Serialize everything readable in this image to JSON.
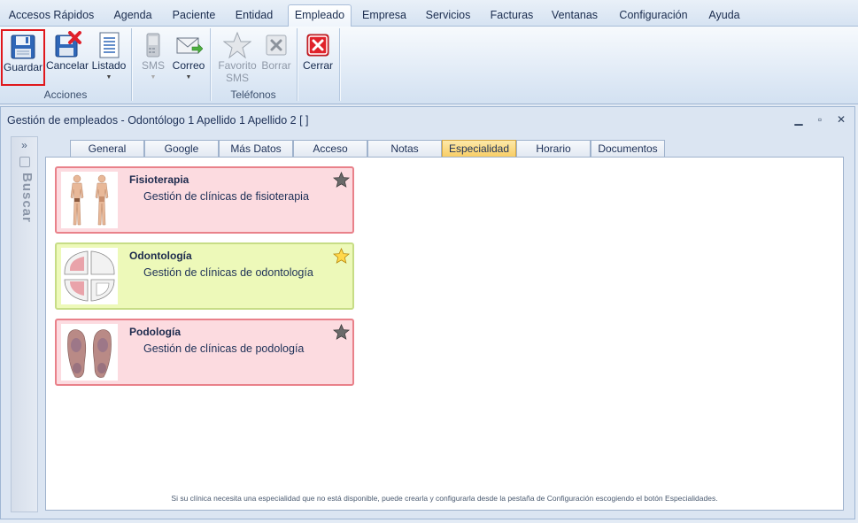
{
  "menu": {
    "tabs": [
      {
        "label": "Accesos Rápidos"
      },
      {
        "label": "Agenda"
      },
      {
        "label": "Paciente"
      },
      {
        "label": "Entidad"
      },
      {
        "label": "Empleado"
      },
      {
        "label": "Empresa"
      },
      {
        "label": "Servicios"
      },
      {
        "label": "Facturas"
      },
      {
        "label": "Ventanas"
      },
      {
        "label": "Configuración"
      },
      {
        "label": "Ayuda"
      }
    ],
    "active": "Empleado"
  },
  "ribbon": {
    "acciones": {
      "group_label": "Acciones",
      "guardar": "Guardar",
      "cancelar": "Cancelar",
      "listado": "Listado"
    },
    "telefonos": {
      "group_label": "Teléfonos",
      "sms": "SMS",
      "correo": "Correo",
      "favorito_sms": "Favorito\nSMS",
      "borrar": "Borrar"
    },
    "cerrar": "Cerrar"
  },
  "window": {
    "title": "Gestión de empleados - Odontólogo 1 Apellido 1 Apellido 2  [ ]",
    "search_panel_label": "Buscar"
  },
  "tabs": [
    {
      "label": "General"
    },
    {
      "label": "Google"
    },
    {
      "label": "Más Datos"
    },
    {
      "label": "Acceso"
    },
    {
      "label": "Notas"
    },
    {
      "label": "Especialidad"
    },
    {
      "label": "Horario"
    },
    {
      "label": "Documentos"
    }
  ],
  "active_tab": "Especialidad",
  "specialties": [
    {
      "title": "Fisioterapia",
      "description": "Gestión de clínicas de fisioterapia",
      "favorite": false,
      "color": "#fcdbe0",
      "image": "body-figure-icon"
    },
    {
      "title": "Odontología",
      "description": "Gestión de clínicas de odontología",
      "favorite": true,
      "color": "#edf9b9",
      "image": "teeth-arch-icon"
    },
    {
      "title": "Podología",
      "description": "Gestión de clínicas de podología",
      "favorite": false,
      "color": "#fcdbe0",
      "image": "feet-soles-icon"
    }
  ],
  "footnote": "Si su clínica necesita una especialidad que no está disponible, puede crearla y configurarla desde la pestaña de Configuración escogiendo el botón Especialidades."
}
